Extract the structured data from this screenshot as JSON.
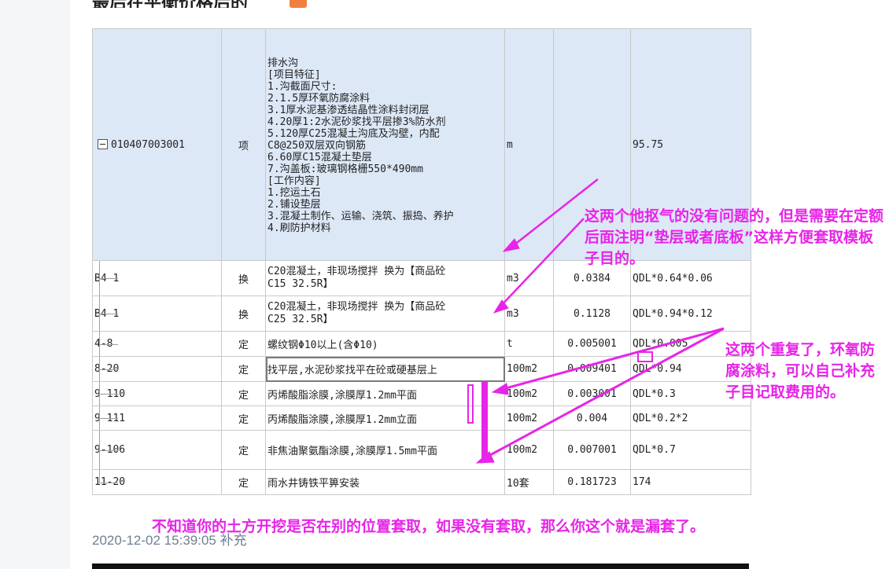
{
  "article": {
    "title_fragment": "最后在平衡价格后的 "
  },
  "table": {
    "main_row": {
      "code": "010407003001",
      "type": "项",
      "description_lines": [
        "排水沟",
        "[项目特征]",
        "1.沟截面尺寸:",
        "2.1.5厚环氧防腐涂料",
        "3.1厚水泥基渗透结晶性涂料封闭层",
        "4.20厚1:2水泥砂浆找平层掺3%防水剂",
        "5.120厚C25混凝土沟底及沟壁，内配",
        "C8@250双层双向钢筋",
        "6.60厚C15混凝土垫层",
        "7.沟盖板:玻璃钢格栅550*490mm",
        "[工作内容]",
        "1.挖运土石",
        "2.铺设垫层",
        "3.混凝土制作、运输、浇筑、振捣、养护",
        "4.刷防护材料"
      ],
      "unit": "m",
      "quantity": "",
      "expression": "95.75"
    },
    "sub_rows": [
      {
        "code": "B4-1",
        "type": "换",
        "desc_line1": "C20混凝土，非现场搅拌  换为【商品砼",
        "desc_line2": "C15 32.5R】",
        "unit": "m3",
        "quantity": "0.0384",
        "expression": "QDL*0.64*0.06"
      },
      {
        "code": "B4-1",
        "type": "换",
        "desc_line1": "C20混凝土，非现场搅拌  换为【商品砼",
        "desc_line2": "C25 32.5R】",
        "unit": "m3",
        "quantity": "0.1128",
        "expression": "QDL*0.94*0.12"
      },
      {
        "code": "4-8",
        "type": "定",
        "desc_line1": "螺纹钢Φ10以上(含Φ10)",
        "desc_line2": "",
        "unit": "t",
        "quantity": "0.005001",
        "expression": "QDL*0.005"
      },
      {
        "code": "8-20",
        "type": "定",
        "desc_line1": "找平层,水泥砂浆找平在砼或硬基层上",
        "desc_line2": "",
        "unit": "100m2",
        "quantity": "0.009401",
        "expression": "QDL*0.94"
      },
      {
        "code": "9-110",
        "type": "定",
        "desc_line1": "丙烯酸脂涂膜,涂膜厚1.2mm平面",
        "desc_line2": "",
        "unit": "100m2",
        "quantity": "0.003001",
        "expression": "QDL*0.3"
      },
      {
        "code": "9-111",
        "type": "定",
        "desc_line1": "丙烯酸脂涂膜,涂膜厚1.2mm立面",
        "desc_line2": "",
        "unit": "100m2",
        "quantity": "0.004",
        "expression": "QDL*0.2*2"
      },
      {
        "code": "9-106",
        "type": "定",
        "desc_line1": "非焦油聚氨酯涂膜,涂膜厚1.5mm平面",
        "desc_line2": "",
        "unit": "100m2",
        "quantity": "0.007001",
        "expression": "QDL*0.7"
      },
      {
        "code": "11-20",
        "type": "定",
        "desc_line1": "雨水井铸铁平箅安装",
        "desc_line2": "",
        "unit": "10套",
        "quantity": "0.181723",
        "expression": "174"
      }
    ]
  },
  "annotations": {
    "note1": "这两个他抠气的没有问题的，但是需要在定额后面注明“垫层或者底板”这样方便套取模板子目的。",
    "note2": "这两个重复了，环氧防腐涂料，可以自己补充子目记取费用的。",
    "note3": "不知道你的土方开挖是否在别的位置套取，如果没有套取，那么你这个就是漏套了。",
    "color": "#e824e8"
  },
  "reply": {
    "timestamp": "2020-12-02 15:39:05 补充"
  }
}
